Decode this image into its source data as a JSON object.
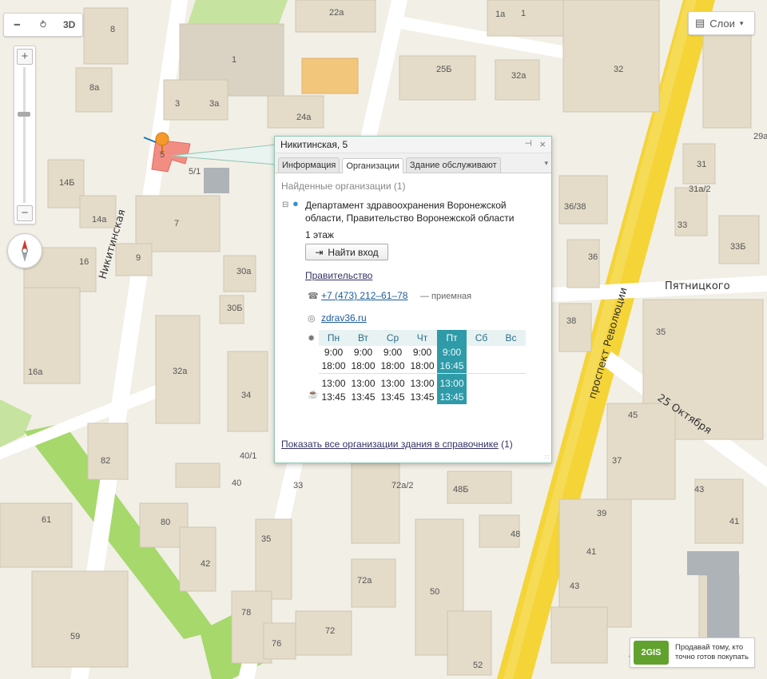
{
  "toolbar": {
    "ruler_icon": "ruler-icon",
    "route_icon": "route-icon",
    "threed_label": "3D"
  },
  "zoom": {
    "in": "+",
    "out": "−",
    "level_fraction": 0.33
  },
  "layers": {
    "label": "Слои",
    "icon": "layers-icon"
  },
  "streets": {
    "nikitinskaya": "Никитинская",
    "revolyutsii": "проспект Революции",
    "pyatnitskogo": "Пятницкого",
    "oktyabrya": "25 Октября"
  },
  "buildings": [
    "8",
    "8а",
    "1",
    "22а",
    "1а",
    "1",
    "25Б",
    "32а",
    "32",
    "3",
    "3а",
    "24а",
    "29а",
    "5",
    "5/1",
    "14Б",
    "14а",
    "7",
    "31",
    "31а/2",
    "33",
    "33Б",
    "36/38",
    "16",
    "9",
    "30а",
    "36",
    "30Б",
    "38",
    "35",
    "16а",
    "32а",
    "34",
    "45",
    "82",
    "40/1",
    "40",
    "33",
    "72а/2",
    "48Б",
    "37",
    "43",
    "61",
    "80",
    "48",
    "39",
    "41",
    "42",
    "35",
    "72а",
    "41",
    "43",
    "50",
    "78",
    "72",
    "45",
    "59",
    "76",
    "52"
  ],
  "colors": {
    "popup_border": "#8dc7b3",
    "today": "#2f9aa8",
    "road_yellow": "#f5d438",
    "marker": "#f39a2a",
    "building_selected": "#f28d84"
  },
  "popup": {
    "title": "Никитинская, 5",
    "pin": "⊣",
    "close": "×",
    "tabs": [
      "Информация",
      "Организации",
      "Здание обслуживают"
    ],
    "active_tab": "Организации",
    "found_label": "Найденные организации (1)",
    "org_name": "Департамент здравоохранения Воронежской области, Правительство Воронежской области",
    "floor": "1 этаж",
    "enter_button": "Найти вход",
    "category": "Правительство",
    "phone": "+7 (473) 212‒61‒78",
    "phone_note": "— приемная",
    "website": "zdrav36.ru",
    "schedule": {
      "days": [
        "Пн",
        "Вт",
        "Ср",
        "Чт",
        "Пт",
        "Сб",
        "Вс"
      ],
      "today_index": 4,
      "work_start": [
        "9:00",
        "9:00",
        "9:00",
        "9:00",
        "9:00",
        "",
        ""
      ],
      "work_end": [
        "18:00",
        "18:00",
        "18:00",
        "18:00",
        "16:45",
        "",
        ""
      ],
      "break_start": [
        "13:00",
        "13:00",
        "13:00",
        "13:00",
        "13:00",
        "",
        ""
      ],
      "break_end": [
        "13:45",
        "13:45",
        "13:45",
        "13:45",
        "13:45",
        "",
        ""
      ]
    },
    "show_all_link": "Показать все организации здания в справочнике",
    "show_all_count": "(1)"
  },
  "ad": {
    "logo": "2GIS",
    "text_line1": "Продавай тому, кто",
    "text_line2": "точно готов покупать"
  }
}
